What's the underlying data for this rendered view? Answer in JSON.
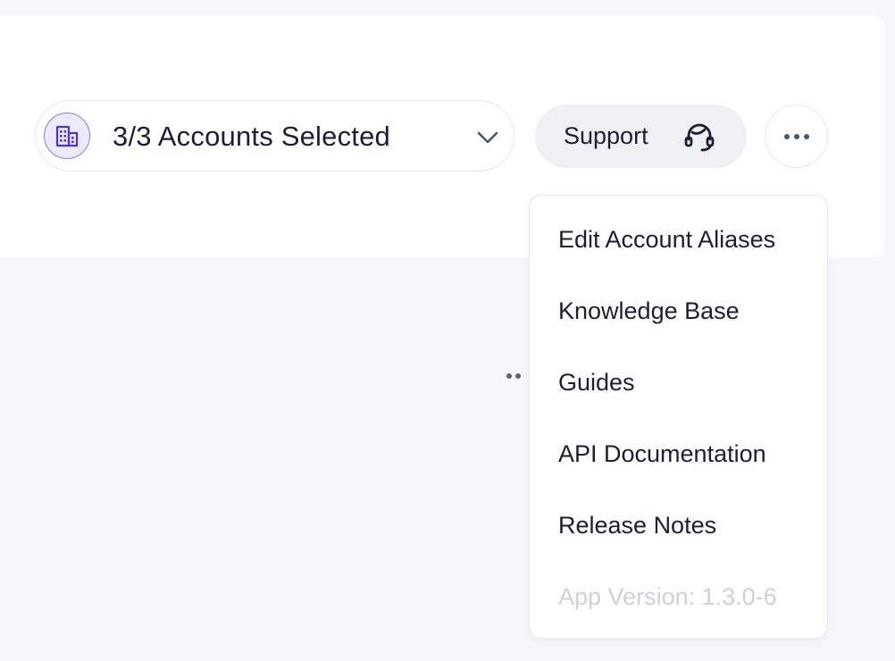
{
  "account_selector": {
    "label": "3/3 Accounts Selected",
    "icon": "building-icon",
    "accent_color": "#4f35c8"
  },
  "toolbar": {
    "support_label": "Support",
    "support_icon": "headset-icon",
    "more_icon": "more-horizontal-icon"
  },
  "menu": {
    "items": [
      {
        "label": "Edit Account Aliases"
      },
      {
        "label": "Knowledge Base"
      },
      {
        "label": "Guides"
      },
      {
        "label": "API Documentation"
      },
      {
        "label": "Release Notes"
      }
    ],
    "version": "App Version: 1.3.0-6"
  }
}
